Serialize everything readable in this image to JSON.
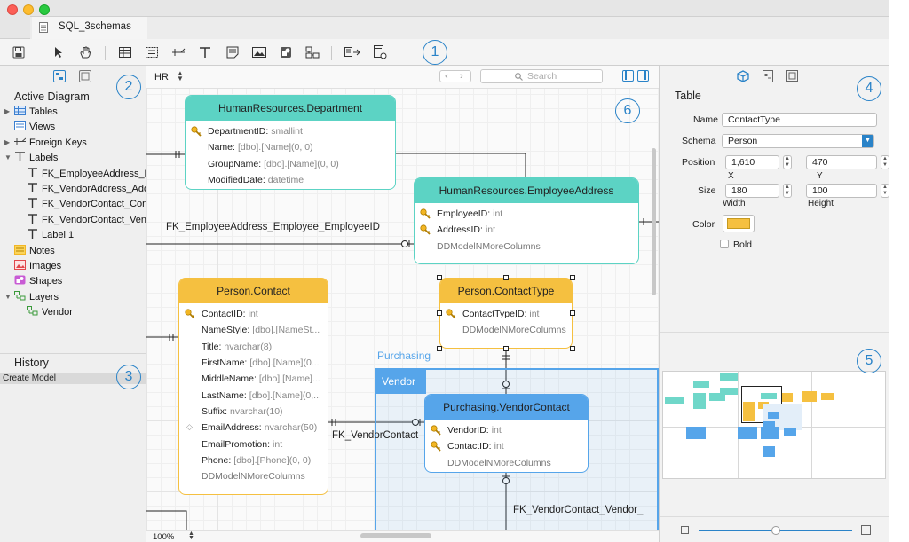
{
  "window": {
    "title": "SQL_3schemas"
  },
  "toolbar": {
    "items": [
      "save",
      "select",
      "pan",
      "table",
      "view",
      "relation",
      "label",
      "note",
      "image",
      "shape",
      "layer",
      "generate",
      "layout"
    ]
  },
  "callouts": [
    "1",
    "2",
    "3",
    "4",
    "5",
    "6"
  ],
  "left_panel": {
    "section_title": "Active Diagram",
    "tree": [
      {
        "label": "Tables",
        "icon": "table-icon",
        "expander": "▶"
      },
      {
        "label": "Views",
        "icon": "view-icon",
        "expander": ""
      },
      {
        "label": "Foreign Keys",
        "icon": "foreign-key-icon",
        "expander": "▶"
      },
      {
        "label": "Labels",
        "icon": "label-icon",
        "expander": "▼"
      },
      {
        "label": "FK_EmployeeAddress_E...",
        "icon": "label-icon",
        "expander": ""
      },
      {
        "label": "FK_VendorAddress_Add...",
        "icon": "label-icon",
        "expander": ""
      },
      {
        "label": "FK_VendorContact_Con...",
        "icon": "label-icon",
        "expander": ""
      },
      {
        "label": "FK_VendorContact_Ven...",
        "icon": "label-icon",
        "expander": ""
      },
      {
        "label": "Label 1",
        "icon": "label-icon",
        "expander": ""
      },
      {
        "label": "Notes",
        "icon": "note-icon",
        "expander": ""
      },
      {
        "label": "Images",
        "icon": "image-icon",
        "expander": ""
      },
      {
        "label": "Shapes",
        "icon": "shape-icon",
        "expander": ""
      },
      {
        "label": "Layers",
        "icon": "layer-icon",
        "expander": "▼"
      },
      {
        "label": "Vendor",
        "icon": "layer-icon",
        "expander": ""
      }
    ],
    "history_title": "History",
    "history_items": [
      "Create Model"
    ]
  },
  "canvas": {
    "schema_select": "HR",
    "search_placeholder": "Search",
    "zoom": "100%",
    "entities": {
      "department": {
        "title": "HumanResources.Department",
        "rows": [
          {
            "name": "DepartmentID:",
            "type": "smallint",
            "key": true
          },
          {
            "name": "Name:",
            "type": "[dbo].[Name](0, 0)",
            "key": false
          },
          {
            "name": "GroupName:",
            "type": "[dbo].[Name](0, 0)",
            "key": false
          },
          {
            "name": "ModifiedDate:",
            "type": "datetime",
            "key": false
          }
        ]
      },
      "employee_address": {
        "title": "HumanResources.EmployeeAddress",
        "rows": [
          {
            "name": "EmployeeID:",
            "type": "int",
            "key": true
          },
          {
            "name": "AddressID:",
            "type": "int",
            "key": true
          }
        ],
        "more": "DDModelNMoreColumns"
      },
      "contact": {
        "title": "Person.Contact",
        "rows": [
          {
            "name": "ContactID:",
            "type": "int",
            "key": true
          },
          {
            "name": "NameStyle:",
            "type": "[dbo].[NameSt...",
            "key": false
          },
          {
            "name": "Title:",
            "type": "nvarchar(8)",
            "key": false
          },
          {
            "name": "FirstName:",
            "type": "[dbo].[Name](0...",
            "key": false
          },
          {
            "name": "MiddleName:",
            "type": "[dbo].[Name]...",
            "key": false
          },
          {
            "name": "LastName:",
            "type": "[dbo].[Name](0,...",
            "key": false
          },
          {
            "name": "Suffix:",
            "type": "nvarchar(10)",
            "key": false
          },
          {
            "name": "EmailAddress:",
            "type": "nvarchar(50)",
            "key": false,
            "index": true
          },
          {
            "name": "EmailPromotion:",
            "type": "int",
            "key": false
          },
          {
            "name": "Phone:",
            "type": "[dbo].[Phone](0, 0)",
            "key": false
          }
        ],
        "more": "DDModelNMoreColumns"
      },
      "contact_type": {
        "title": "Person.ContactType",
        "rows": [
          {
            "name": "ContactTypeID:",
            "type": "int",
            "key": true
          }
        ],
        "more": "DDModelNMoreColumns"
      },
      "vendor_contact": {
        "title": "Purchasing.VendorContact",
        "rows": [
          {
            "name": "VendorID:",
            "type": "int",
            "key": true
          },
          {
            "name": "ContactID:",
            "type": "int",
            "key": true
          }
        ],
        "more": "DDModelNMoreColumns"
      }
    },
    "labels": {
      "fk_employee": "FK_EmployeeAddress_Employee_EmployeeID",
      "fk_vendorcontact": "FK_VendorContact",
      "fk_vendorcontact_vendor": "FK_VendorContact_Vendor_",
      "purchasing": "Purchasing",
      "vendor_layer": "Vendor"
    }
  },
  "right_panel": {
    "title": "Table",
    "name_label": "Name",
    "name_value": "ContactType",
    "schema_label": "Schema",
    "schema_value": "Person",
    "position_label": "Position",
    "pos_x": "1,610",
    "pos_y": "470",
    "x_caption": "X",
    "y_caption": "Y",
    "size_label": "Size",
    "width": "180",
    "height": "100",
    "width_caption": "Width",
    "height_caption": "Height",
    "color_label": "Color",
    "color_value": "#f5c040",
    "bold_label": "Bold",
    "zoom_fraction": 0.5
  },
  "colors": {
    "teal": "#5cd3c4",
    "orange": "#f5c040",
    "blue": "#56a5ea",
    "accent": "#2a83c8"
  }
}
